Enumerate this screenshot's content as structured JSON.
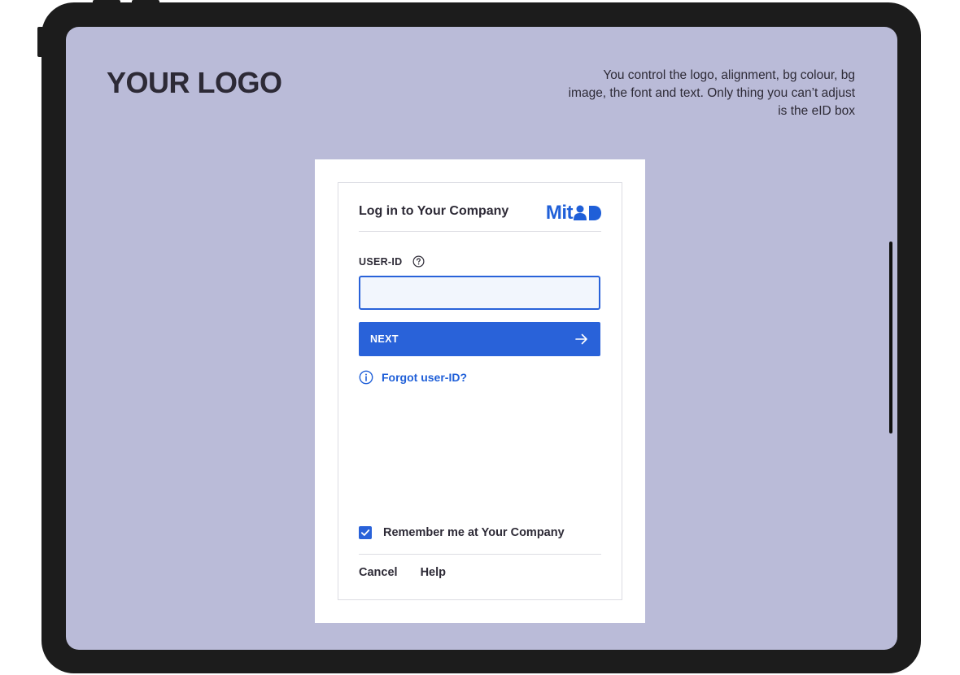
{
  "page": {
    "logo_text": "YOUR LOGO",
    "note_text": "You control the logo, alignment, bg colour, bg image, the font and text. Only thing you can’t adjust is the eID box"
  },
  "login": {
    "title": "Log in to Your Company",
    "brand_text": "Mit",
    "brand_icon": "person-id-icon",
    "field_label": "USER-ID",
    "field_help_icon": "question-circle-icon",
    "field_value": "",
    "next_label": "NEXT",
    "next_icon": "arrow-right-icon",
    "forgot_icon": "info-circle-icon",
    "forgot_label": "Forgot user-ID?",
    "remember_label": "Remember me at Your Company",
    "remember_checked": true,
    "cancel_label": "Cancel",
    "help_label": "Help"
  },
  "colors": {
    "background": "#babbd8",
    "device_frame": "#1c1c1c",
    "accent": "#2962d9",
    "brand_blue": "#1f5fd8",
    "text": "#2d2a36",
    "input_fill": "#f2f6fd"
  }
}
